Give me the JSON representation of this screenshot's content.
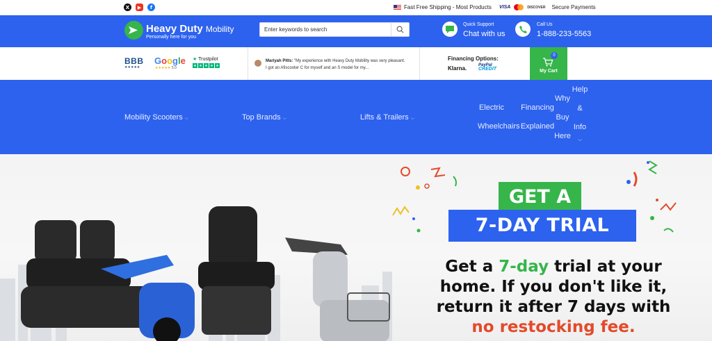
{
  "topbar": {
    "social": [
      "x-icon",
      "youtube-icon",
      "facebook-icon"
    ],
    "shipping_text": "Fast Free Shipping - Most Products",
    "payments_text": "Secure Payments",
    "card_visa": "VISA",
    "card_discover": "DISCOVER"
  },
  "header": {
    "brand_bold": "Heavy Duty",
    "brand_light": "Mobility",
    "tagline": "Personally here for you",
    "search_placeholder": "Enter keywords to search",
    "support_label": "Quick Support",
    "support_action": "Chat with us",
    "call_label": "Call Us",
    "call_number": "1-888-233-5563"
  },
  "trust": {
    "bbb": "BBB",
    "bbb_stars": "★★★★★",
    "google": [
      "G",
      "o",
      "o",
      "g",
      "l",
      "e"
    ],
    "google_stars": "★★★★★",
    "google_score": "5.0",
    "trustpilot": "Trustpilot",
    "review_author": "Mariyah Pitts:",
    "review_line1": "\"My experience with Heavy Duty Mobility was very pleasant.",
    "review_line2": "I got an Afiscooter C for myself and an S model for my...",
    "financing_label": "Financing Options:",
    "klarna": "Klarna.",
    "paypal_top": "PayPal",
    "paypal_bottom": "CREDIT"
  },
  "cart": {
    "count": "0",
    "label": "My Cart"
  },
  "nav": {
    "mobility_scooters": "Mobility Scooters",
    "top_brands": "Top Brands",
    "lifts_trailers": "Lifts & Trailers",
    "electric_wheelchairs": [
      "Electric",
      "Wheelchairs"
    ],
    "financing_explained": [
      "Financing",
      "Explained"
    ],
    "why_buy_here": [
      "Why",
      "Buy",
      "Here"
    ],
    "help_info": [
      "Help",
      "&",
      "Info"
    ]
  },
  "hero": {
    "badge_top": "GET A",
    "badge_main": "7-DAY TRIAL",
    "line1_a": "Get a ",
    "line1_green": "7-day",
    "line1_b": " trial at your",
    "line2": "home. If you don't like it,",
    "line3": "return it after 7 days with",
    "line4_red": "no restocking fee."
  },
  "colors": {
    "brand_blue": "#2d62ef",
    "brand_green": "#36b54a",
    "accent_red": "#e34a2a"
  }
}
